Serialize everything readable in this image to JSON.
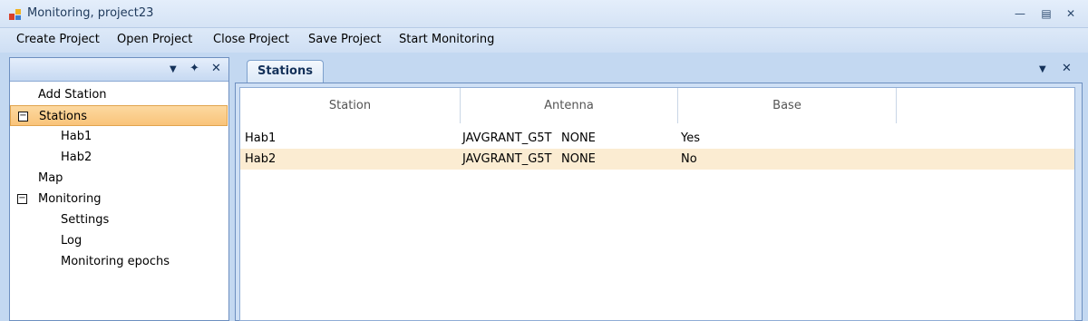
{
  "window": {
    "title": "Monitoring, project23"
  },
  "menu": [
    "Create Project",
    "Open Project",
    "Close Project",
    "Save Project",
    "Start Monitoring"
  ],
  "tree": {
    "items": [
      {
        "label": "Add Station",
        "level": 0,
        "expander": ""
      },
      {
        "label": "Stations",
        "level": 0,
        "expander": "−",
        "selected": true
      },
      {
        "label": "Hab1",
        "level": 1,
        "expander": ""
      },
      {
        "label": "Hab2",
        "level": 1,
        "expander": ""
      },
      {
        "label": "Map",
        "level": 0,
        "expander": ""
      },
      {
        "label": "Monitoring",
        "level": 0,
        "expander": "−"
      },
      {
        "label": "Settings",
        "level": 1,
        "expander": ""
      },
      {
        "label": "Log",
        "level": 1,
        "expander": ""
      },
      {
        "label": "Monitoring epochs",
        "level": 1,
        "expander": ""
      }
    ]
  },
  "tab": {
    "label": "Stations"
  },
  "grid": {
    "columns": [
      "Station",
      "Antenna",
      "Base"
    ],
    "rows": [
      {
        "station": "Hab1",
        "antenna": "JAVGRANT_G5T",
        "radome": "NONE",
        "base": "Yes",
        "selected": false
      },
      {
        "station": "Hab2",
        "antenna": "JAVGRANT_G5T",
        "radome": "NONE",
        "base": "No",
        "selected": true
      }
    ]
  },
  "colors": {
    "accent": "#15325a",
    "selection": "#f9c47a",
    "row_selection": "#fbecd2"
  }
}
